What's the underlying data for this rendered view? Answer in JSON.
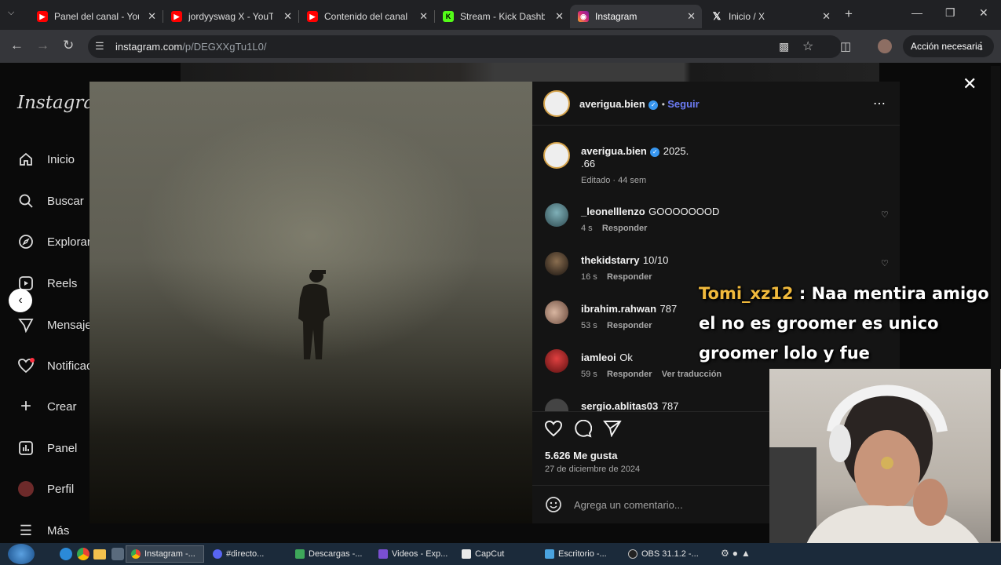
{
  "browser": {
    "tabs": [
      {
        "label": "Panel del canal - YouT",
        "icon": "youtube-icon",
        "color": "#ff0000"
      },
      {
        "label": "jordyyswag X - YouTu",
        "icon": "youtube-icon",
        "color": "#ff0000"
      },
      {
        "label": "Contenido del canal",
        "icon": "youtube-icon",
        "color": "#ff0000"
      },
      {
        "label": "Stream - Kick Dashbo",
        "icon": "kick-icon",
        "color": "#53fc18"
      },
      {
        "label": "Instagram",
        "icon": "instagram-icon",
        "color": "#d62976"
      },
      {
        "label": "Inicio / X",
        "icon": "x-icon",
        "color": "#ffffff"
      }
    ],
    "url_host": "instagram.com",
    "url_path": "/p/DEGXXgTu1L0/",
    "action_label": "Acción necesaria"
  },
  "sidebar": {
    "logo": "Instagram",
    "items": [
      {
        "label": "Inicio",
        "icon": "home-icon"
      },
      {
        "label": "Buscar",
        "icon": "search-icon"
      },
      {
        "label": "Explorar",
        "icon": "compass-icon"
      },
      {
        "label": "Reels",
        "icon": "reels-icon"
      },
      {
        "label": "Mensajes",
        "icon": "messenger-icon"
      },
      {
        "label": "Notificaciones",
        "icon": "heart-icon"
      },
      {
        "label": "Crear",
        "icon": "plus-icon"
      },
      {
        "label": "Panel",
        "icon": "dashboard-icon"
      },
      {
        "label": "Perfil",
        "icon": "profile-icon"
      },
      {
        "label": "Más",
        "icon": "menu-icon"
      }
    ]
  },
  "post": {
    "author": "averigua.bien",
    "follow_label": "Seguir",
    "caption": "2025.",
    "caption_line2": ".66",
    "caption_meta": "Editado · 44 sem",
    "comments": [
      {
        "user": "_leonelllenzo",
        "text": "GOOOOOOOD",
        "time": "4 s",
        "reply": "Responder",
        "translate": ""
      },
      {
        "user": "thekidstarry",
        "text": "10/10",
        "time": "16 s",
        "reply": "Responder",
        "translate": ""
      },
      {
        "user": "ibrahim.rahwan",
        "text": "787",
        "time": "53 s",
        "reply": "Responder",
        "translate": ""
      },
      {
        "user": "iamleoi",
        "text": "Ok",
        "time": "59 s",
        "reply": "Responder",
        "translate": "Ver traducción"
      },
      {
        "user": "sergio.ablitas03",
        "text": "787",
        "time": "",
        "reply": "",
        "translate": ""
      }
    ],
    "likes": "5.626 Me gusta",
    "date": "27 de diciembre de 2024",
    "comment_placeholder": "Agrega un comentario..."
  },
  "overlay": {
    "chat_user": "Tomi_xz12",
    "chat_sep": ":",
    "chat_message": "Naa mentira amigo el no es groomer es unico groomer lolo y fue"
  },
  "taskbar": {
    "items": [
      {
        "label": "Instagram -...",
        "icon": "chrome-icon"
      },
      {
        "label": "#​directo...",
        "icon": "discord-icon"
      },
      {
        "label": "Descargas -...",
        "icon": "download-icon"
      },
      {
        "label": "Videos - Exp...",
        "icon": "video-icon"
      },
      {
        "label": "CapCut",
        "icon": "capcut-icon"
      },
      {
        "label": "Escritorio -...",
        "icon": "folder-icon"
      },
      {
        "label": "OBS 31.1.2 -...",
        "icon": "obs-icon"
      }
    ]
  },
  "colors": {
    "accent_link": "#6c7cf5",
    "chat_username": "#f0b93c"
  }
}
